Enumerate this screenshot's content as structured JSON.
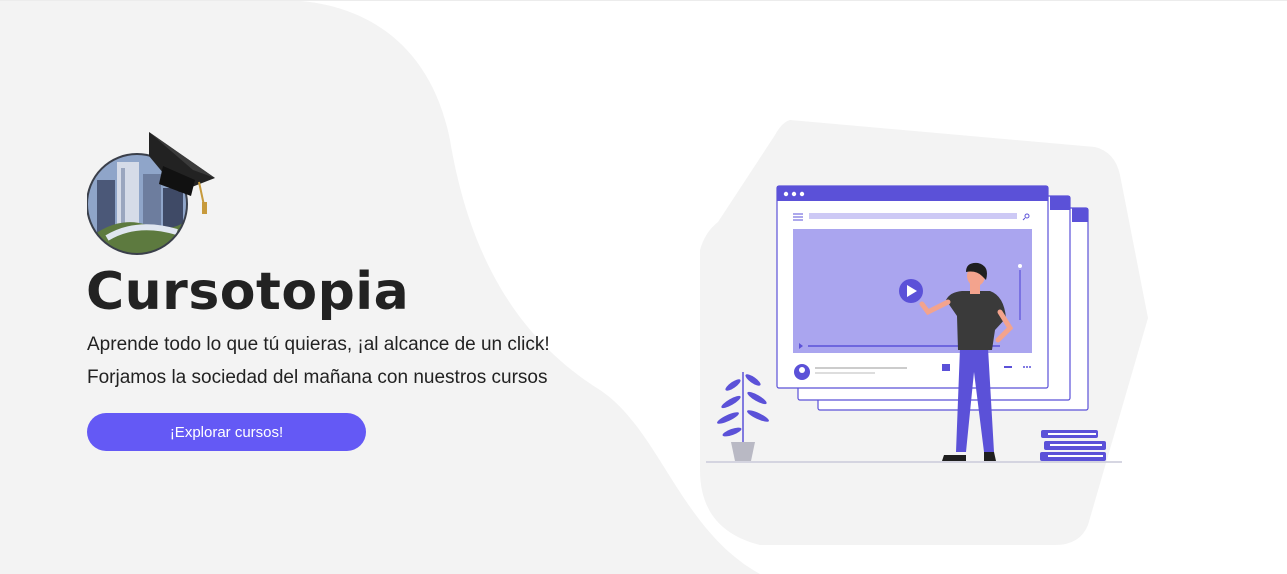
{
  "hero": {
    "title": "Cursotopia",
    "line1": "Aprende todo lo que tú quieras, ¡al alcance de un click!",
    "line2": "Forjamos la sociedad del mañana con nuestros cursos",
    "cta_label": "¡Explorar cursos!"
  },
  "colors": {
    "accent": "#6459f5",
    "blob": "#f3f3f3",
    "illustration_purple": "#5b51d8"
  },
  "icons": {
    "logo": "graduation-cap-city-logo",
    "illustration": "video-lesson-person-illustration"
  }
}
